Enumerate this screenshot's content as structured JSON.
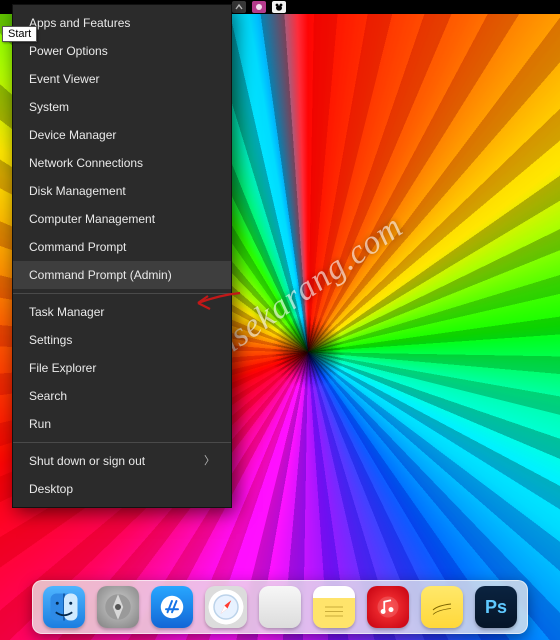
{
  "tooltip": {
    "start": "Start"
  },
  "watermark": "jamansekarang.com",
  "menu": {
    "group1": [
      "Apps and Features",
      "Power Options",
      "Event Viewer",
      "System",
      "Device Manager",
      "Network Connections",
      "Disk Management",
      "Computer Management",
      "Command Prompt",
      "Command Prompt (Admin)"
    ],
    "group2": [
      "Task Manager",
      "Settings",
      "File Explorer",
      "Search",
      "Run"
    ],
    "group3": [
      {
        "label": "Shut down or sign out",
        "submenu": true
      },
      {
        "label": "Desktop",
        "submenu": false
      }
    ],
    "highlighted_index": 9
  },
  "tray_icons": [
    "up-arrow-icon",
    "app-icon",
    "panda-icon"
  ],
  "dock": [
    {
      "id": "finder",
      "name": "Finder"
    },
    {
      "id": "launchpad",
      "name": "Launchpad"
    },
    {
      "id": "appstore",
      "name": "App Store"
    },
    {
      "id": "safari",
      "name": "Safari"
    },
    {
      "id": "blank",
      "name": "Blank"
    },
    {
      "id": "notes",
      "name": "Notes"
    },
    {
      "id": "itunes",
      "name": "iTunes"
    },
    {
      "id": "stickies",
      "name": "Stickies"
    },
    {
      "id": "photoshop",
      "name": "Photoshop"
    }
  ],
  "arrow_color": "#c21818"
}
